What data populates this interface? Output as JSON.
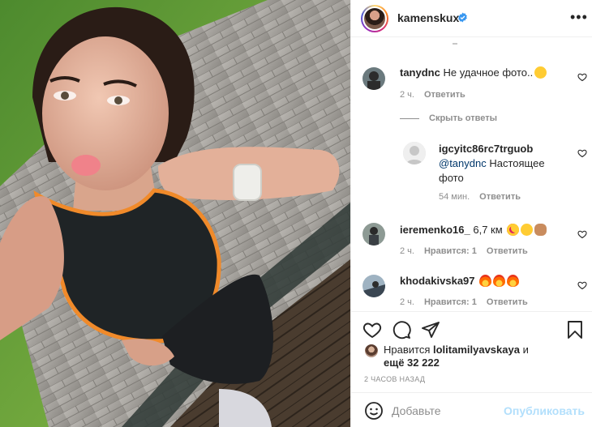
{
  "header": {
    "username": "kamenskux",
    "verified": true,
    "more_icon": "more-horizontal-icon"
  },
  "comments": [
    {
      "user": "tanydnc",
      "text": "Не удачное фото..",
      "emoji": [
        "smiling-face"
      ],
      "time": "2 ч.",
      "reply_label": "Ответить"
    }
  ],
  "hide_replies_label": "Скрыть ответы",
  "reply": {
    "user": "igcyitc86rc7trguob",
    "mention": "@tanydnc",
    "text": " Настоящее фото",
    "time": "54 мин.",
    "reply_label": "Ответить"
  },
  "comments2": [
    {
      "user": "ieremenko16_",
      "text": "6,7 км",
      "emoji": [
        "heart-eyes",
        "sweat-smile",
        "ok-hand"
      ],
      "time": "2 ч.",
      "likes_label": "Нравится: 1",
      "reply_label": "Ответить"
    },
    {
      "user": "khodakivska97",
      "text": "",
      "emoji": [
        "fire",
        "fire",
        "fire"
      ],
      "time": "2 ч.",
      "likes_label": "Нравится: 1",
      "reply_label": "Ответить"
    }
  ],
  "likes": {
    "prefix": "Нравится",
    "user": "lolitamilyavskaya",
    "suffix": "и",
    "others_label": "ещё 32 222"
  },
  "time_ago": "2 часов назад",
  "composer": {
    "placeholder": "Добавьте",
    "publish_label": "Опубликовать"
  },
  "colors": {
    "link": "#00376b",
    "publish_disabled": "#b2dffc",
    "verified": "#3897f0",
    "muted": "#8e8e8e"
  }
}
